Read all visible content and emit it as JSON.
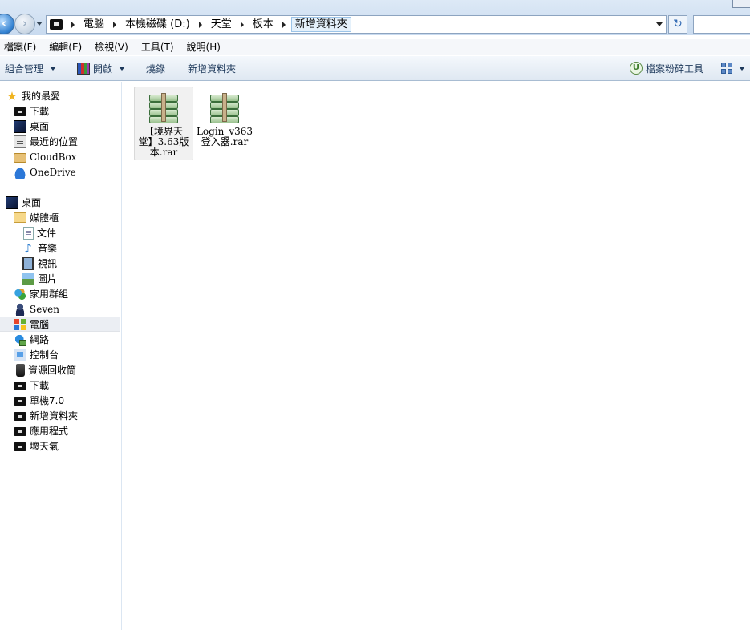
{
  "address": {
    "crumbs": [
      "電腦",
      "本機磁碟 (D:)",
      "天堂",
      "板本",
      "新增資料夾"
    ]
  },
  "menubar": [
    "檔案(F)",
    "編輯(E)",
    "檢視(V)",
    "工具(T)",
    "說明(H)"
  ],
  "commandbar": {
    "organize": "組合管理",
    "open": "開啟",
    "burn": "燒錄",
    "new_folder": "新增資料夾",
    "shredder": "檔案粉碎工具"
  },
  "nav": {
    "favorites_header": "我的最愛",
    "favorites": [
      {
        "label": "下載",
        "icon": "folder-icon"
      },
      {
        "label": "桌面",
        "icon": "desktop-icon"
      },
      {
        "label": "最近的位置",
        "icon": "recent-places-icon"
      },
      {
        "label": "CloudBox",
        "icon": "cloudbox-icon"
      },
      {
        "label": "OneDrive",
        "icon": "onedrive-icon"
      }
    ],
    "desktop_header": "桌面",
    "tree": [
      {
        "label": "媒體櫃",
        "icon": "library-icon"
      },
      {
        "label": "文件",
        "icon": "documents-icon"
      },
      {
        "label": "音樂",
        "icon": "music-icon"
      },
      {
        "label": "視訊",
        "icon": "video-icon"
      },
      {
        "label": "圖片",
        "icon": "pictures-icon"
      },
      {
        "label": "家用群組",
        "icon": "homegroup-icon"
      },
      {
        "label": "Seven",
        "icon": "user-icon"
      },
      {
        "label": "電腦",
        "icon": "computer-icon"
      },
      {
        "label": "網路",
        "icon": "network-icon"
      },
      {
        "label": "控制台",
        "icon": "control-panel-icon"
      },
      {
        "label": "資源回收筒",
        "icon": "recycle-bin-icon"
      },
      {
        "label": "下載",
        "icon": "folder-icon"
      },
      {
        "label": "單機7.0",
        "icon": "folder-icon"
      },
      {
        "label": "新增資料夾",
        "icon": "folder-icon"
      },
      {
        "label": "應用程式",
        "icon": "folder-icon"
      },
      {
        "label": "壞天氣",
        "icon": "folder-icon"
      }
    ]
  },
  "files": [
    {
      "name": "【境界天堂】3.63版本.rar",
      "line1": "【境界天",
      "line2": "堂】3.63版",
      "line3": "本.rar",
      "icon": "winrar-archive-icon"
    },
    {
      "name": "Login_v363登入器.rar",
      "line1": "Login_v363",
      "line2": "登入器.rar",
      "line3": "",
      "icon": "winrar-archive-icon"
    }
  ]
}
